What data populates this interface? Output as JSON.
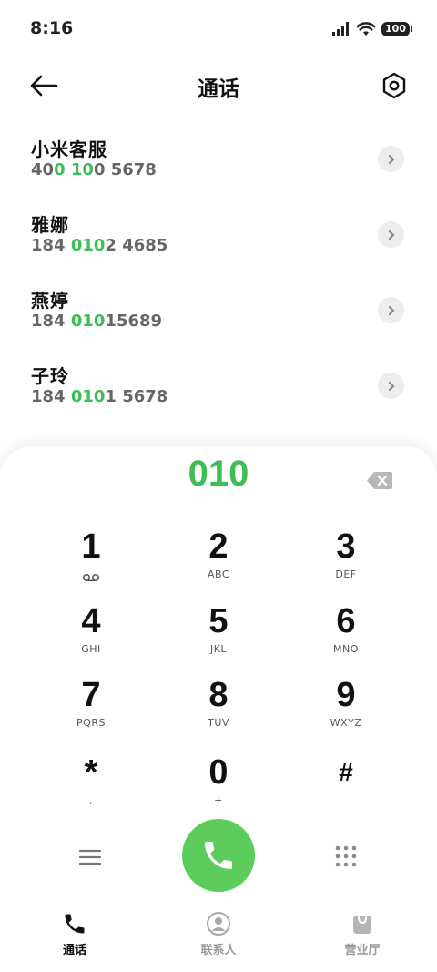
{
  "status_bar": {
    "time": "8:16",
    "battery": "100",
    "icons": [
      "signal-icon",
      "wifi-icon",
      "battery-icon"
    ]
  },
  "header": {
    "title": "通话",
    "back_icon": "arrow-left-icon",
    "settings_icon": "hexagon-settings-icon"
  },
  "contacts": [
    {
      "name": "小米客服",
      "number_parts": [
        {
          "t": "40",
          "h": false
        },
        {
          "t": "0",
          "h": true
        },
        {
          "t": " ",
          "h": false
        },
        {
          "t": "10",
          "h": true
        },
        {
          "t": "0 5678",
          "h": false
        }
      ]
    },
    {
      "name": "雅娜",
      "number_parts": [
        {
          "t": "184 ",
          "h": false
        },
        {
          "t": "010",
          "h": true
        },
        {
          "t": "2 4685",
          "h": false
        }
      ]
    },
    {
      "name": "燕婷",
      "number_parts": [
        {
          "t": "184 ",
          "h": false
        },
        {
          "t": "010",
          "h": true
        },
        {
          "t": "15689",
          "h": false
        }
      ]
    },
    {
      "name": "子玲",
      "number_parts": [
        {
          "t": "184 ",
          "h": false
        },
        {
          "t": "010",
          "h": true
        },
        {
          "t": "1 5678",
          "h": false
        }
      ]
    }
  ],
  "dialpad": {
    "dialed": "010",
    "keys": [
      {
        "digit": "1",
        "letters": "",
        "sub_icon": "voicemail-icon"
      },
      {
        "digit": "2",
        "letters": "ABC"
      },
      {
        "digit": "3",
        "letters": "DEF"
      },
      {
        "digit": "4",
        "letters": "GHI"
      },
      {
        "digit": "5",
        "letters": "JKL"
      },
      {
        "digit": "6",
        "letters": "MNO"
      },
      {
        "digit": "7",
        "letters": "PQRS"
      },
      {
        "digit": "8",
        "letters": "TUV"
      },
      {
        "digit": "9",
        "letters": "WXYZ"
      },
      {
        "digit": "*",
        "letters": ","
      },
      {
        "digit": "0",
        "letters": "+"
      },
      {
        "digit": "#",
        "letters": ""
      }
    ]
  },
  "bottom_nav": [
    {
      "label": "通话",
      "icon": "phone-icon",
      "active": true
    },
    {
      "label": "联系人",
      "icon": "person-icon",
      "active": false
    },
    {
      "label": "营业厅",
      "icon": "shopping-bag-icon",
      "active": false
    }
  ],
  "colors": {
    "accent": "#3dbe55",
    "call_button": "#5ccd5c"
  }
}
